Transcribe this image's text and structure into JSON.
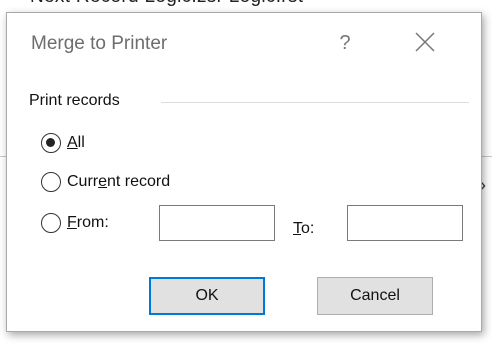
{
  "background": {
    "text": "Next Record   Logic.zsr   Logic.rst",
    "glyph": "›"
  },
  "dialog": {
    "title": "Merge to Printer",
    "help_label": "?",
    "close_icon": "close-icon"
  },
  "print_records": {
    "group_label": "Print records",
    "options": [
      {
        "label_prefix": "",
        "label_accel": "A",
        "label_suffix": "ll",
        "checked": true
      },
      {
        "label_prefix": "Curr",
        "label_accel": "e",
        "label_suffix": "nt record",
        "checked": false
      },
      {
        "label_prefix": "",
        "label_accel": "F",
        "label_suffix": "rom:",
        "checked": false
      }
    ],
    "from_value": "",
    "to_label_accel": "T",
    "to_label_suffix": "o:",
    "to_value": ""
  },
  "buttons": {
    "ok": "OK",
    "cancel": "Cancel"
  },
  "colors": {
    "accent": "#0078d7",
    "button_bg": "#e1e1e1",
    "title_text": "#6d6d6d"
  }
}
